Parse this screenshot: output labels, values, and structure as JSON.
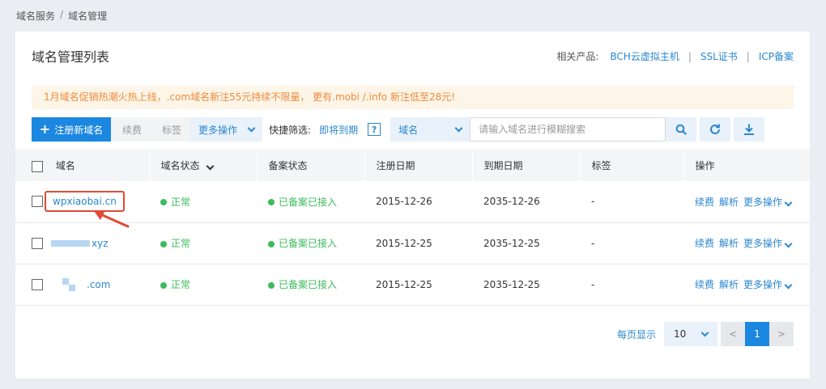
{
  "breadcrumb": {
    "parent": "域名服务",
    "separator": "/",
    "current": "域名管理"
  },
  "panel": {
    "title": "域名管理列表"
  },
  "related": {
    "label": "相关产品:",
    "links": [
      "BCH云虚拟主机",
      "SSL证书",
      "ICP备案"
    ]
  },
  "notice": "1月域名促销热潮火热上线，.com域名新注55元持续不限量， 更有.mobi /.info 新注低至28元!",
  "toolbar": {
    "register_label": "注册新域名",
    "renew_label": "续费",
    "tag_label": "标签",
    "more_label": "更多操作",
    "quick_filter_label": "快捷筛选:",
    "expiring_label": "即将到期",
    "help_glyph": "?",
    "search_type": "域名",
    "search_placeholder": "请输入域名进行模糊搜索"
  },
  "table": {
    "headers": [
      "域名",
      "域名状态",
      "备案状态",
      "注册日期",
      "到期日期",
      "标签",
      "操作"
    ],
    "rows": [
      {
        "domain": "wpxiaobai.cn",
        "status": "正常",
        "icp": "已备案已接入",
        "reg": "2015-12-26",
        "exp": "2035-12-26",
        "tag": "-",
        "renew": "续费",
        "resolve": "解析",
        "more": "更多操作"
      },
      {
        "domain": "xyz",
        "status": "正常",
        "icp": "已备案已接入",
        "reg": "2015-12-25",
        "exp": "2035-12-25",
        "tag": "-",
        "renew": "续费",
        "resolve": "解析",
        "more": "更多操作"
      },
      {
        "domain": ".com",
        "status": "正常",
        "icp": "已备案已接入",
        "reg": "2015-12-25",
        "exp": "2035-12-25",
        "tag": "-",
        "renew": "续费",
        "resolve": "解析",
        "more": "更多操作"
      }
    ]
  },
  "pagination": {
    "per_page_label": "每页显示",
    "per_page": "10",
    "prev": "<",
    "current": "1",
    "next": ">"
  },
  "colors": {
    "primary": "#1b87e0",
    "link": "#2a87d0",
    "notice_text": "#f0893a",
    "success": "#3dbb5c",
    "highlight": "#e04a35"
  }
}
